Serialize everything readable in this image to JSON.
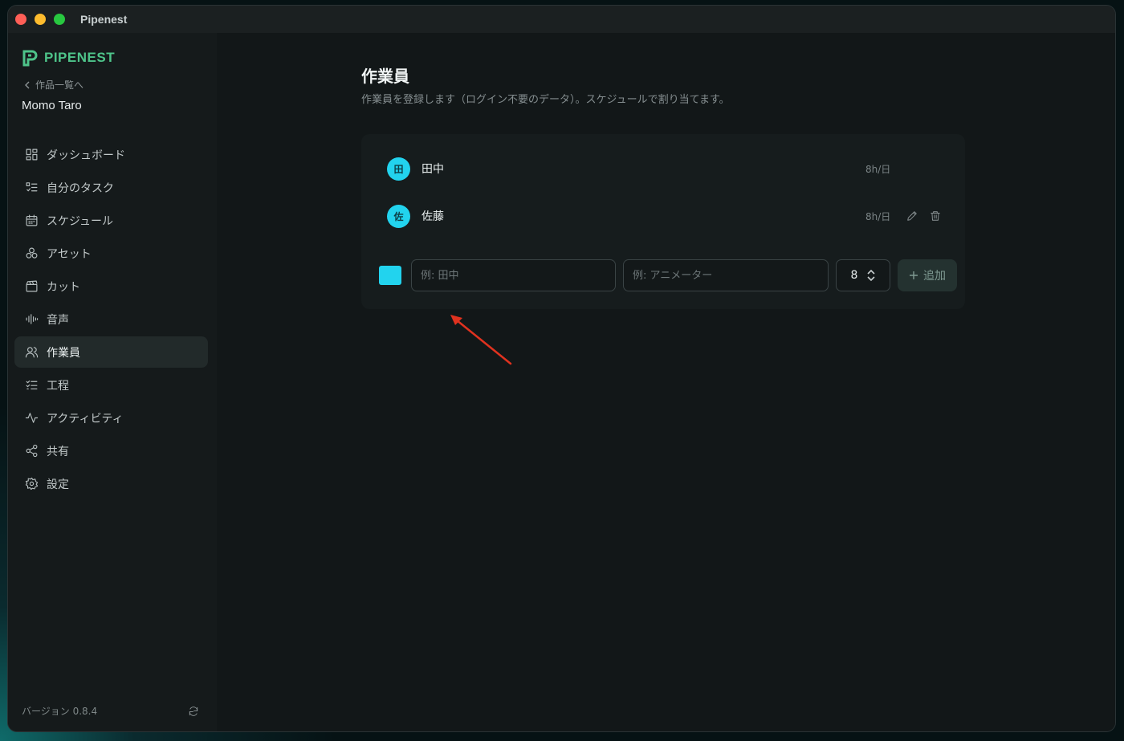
{
  "window": {
    "title": "Pipenest"
  },
  "sidebar": {
    "brand": "PIPENEST",
    "back_label": "作品一覧へ",
    "project_name": "Momo Taro",
    "items": [
      {
        "label": "ダッシュボード",
        "icon": "dashboard-grid-icon"
      },
      {
        "label": "自分のタスク",
        "icon": "task-list-icon"
      },
      {
        "label": "スケジュール",
        "icon": "calendar-icon"
      },
      {
        "label": "アセット",
        "icon": "assets-icon"
      },
      {
        "label": "カット",
        "icon": "clapperboard-icon"
      },
      {
        "label": "音声",
        "icon": "audio-wave-icon"
      },
      {
        "label": "作業員",
        "icon": "users-icon",
        "active": true
      },
      {
        "label": "工程",
        "icon": "checklist-icon"
      },
      {
        "label": "アクティビティ",
        "icon": "activity-icon"
      },
      {
        "label": "共有",
        "icon": "share-icon"
      },
      {
        "label": "設定",
        "icon": "gear-icon"
      }
    ],
    "version": "バージョン 0.8.4"
  },
  "page": {
    "title": "作業員",
    "description": "作業員を登録します（ログイン不要のデータ）。スケジュールで割り当てます。"
  },
  "members": [
    {
      "initial": "田",
      "name": "田中",
      "hours": "8h/日"
    },
    {
      "initial": "佐",
      "name": "佐藤",
      "hours": "8h/日"
    }
  ],
  "add_form": {
    "color": "#22d3ee",
    "name_placeholder": "例: 田中",
    "role_placeholder": "例: アニメーター",
    "hours_value": "8",
    "add_label": "追加"
  },
  "colors": {
    "accent": "#4ec48a",
    "avatar": "#22d3ee",
    "annotation_arrow": "#e0321f"
  }
}
